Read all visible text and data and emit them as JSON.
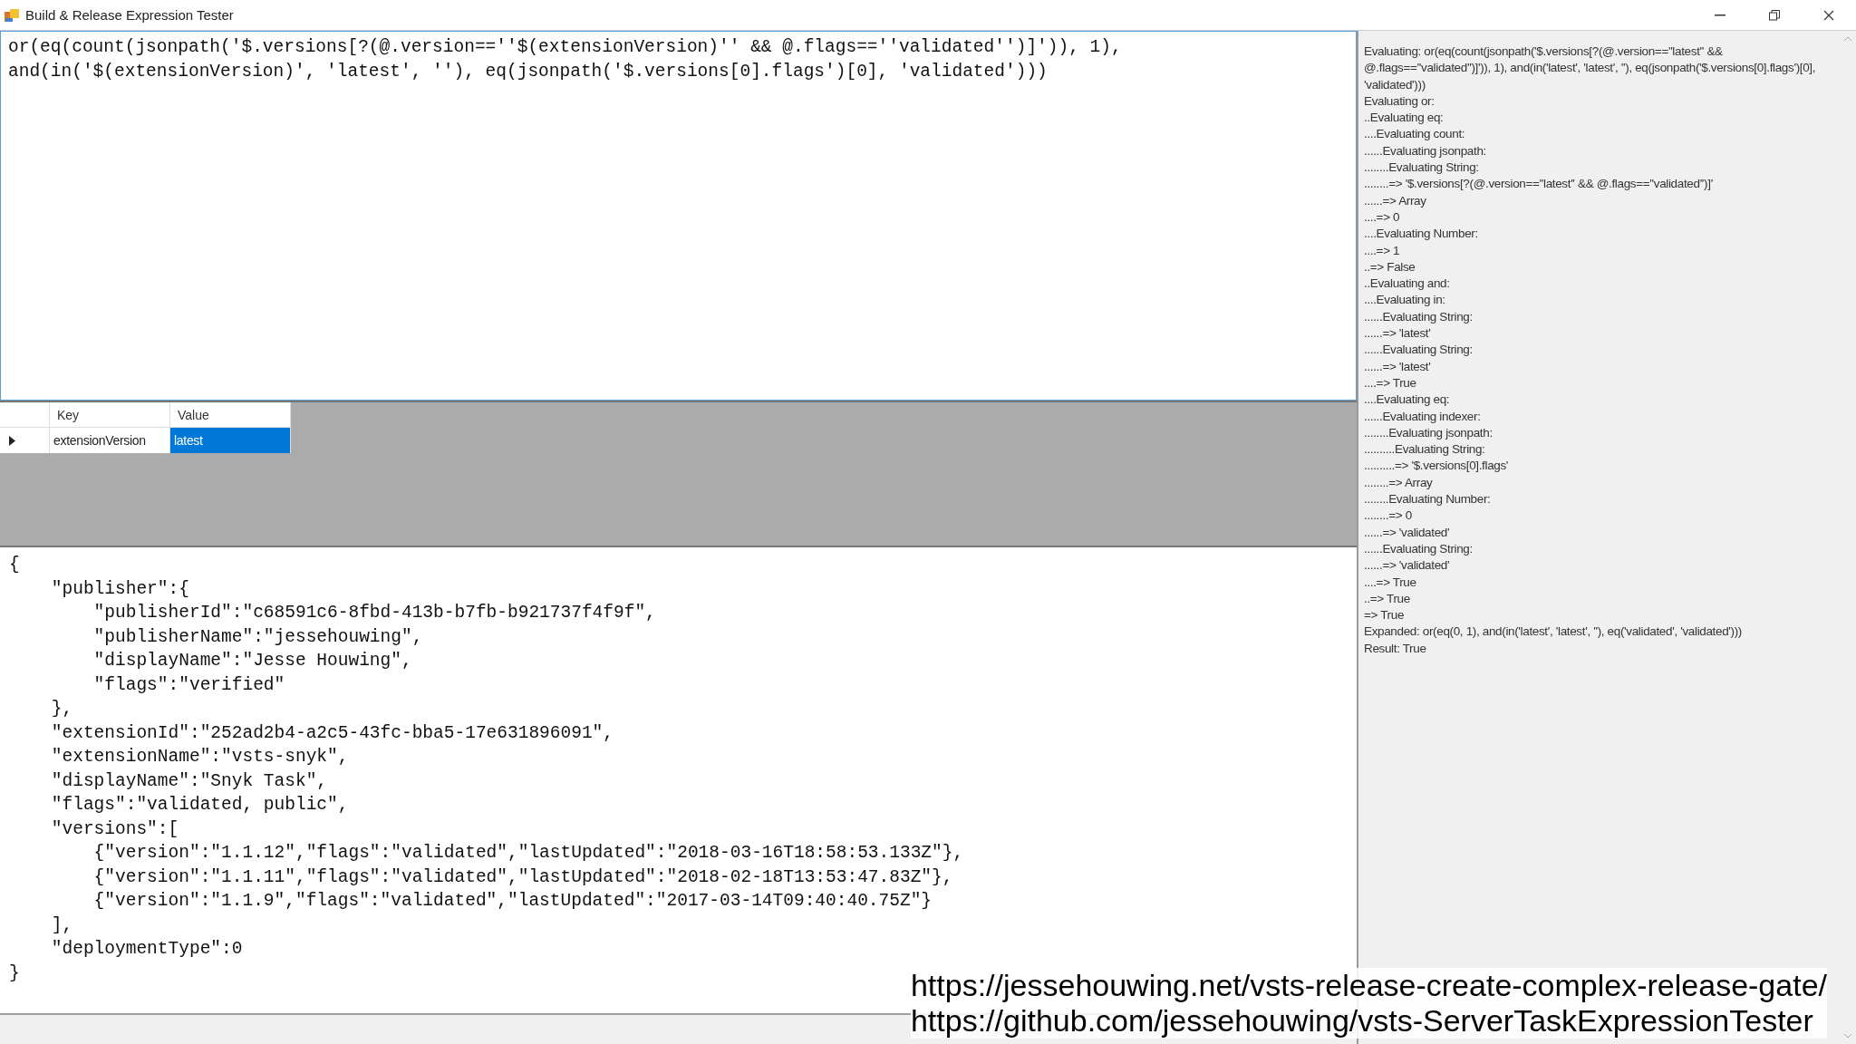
{
  "window": {
    "title": "Build & Release Expression Tester",
    "controls": [
      {
        "kind": "minimize"
      },
      {
        "kind": "restore"
      },
      {
        "kind": "close"
      }
    ]
  },
  "expression": {
    "value": "or(eq(count(jsonpath('$.versions[?(@.version==''$(extensionVersion)'' && @.flags==''validated'')]')), 1), and(in('$(extensionVersion)', 'latest', ''), eq(jsonpath('$.versions[0].flags')[0], 'validated')))"
  },
  "variables": {
    "columns": [
      "Key",
      "Value"
    ],
    "rows": [
      {
        "key": "extensionVersion",
        "value": "latest",
        "current": true,
        "selected": true
      }
    ]
  },
  "json_text": "{\n    \"publisher\":{\n        \"publisherId\":\"c68591c6-8fbd-413b-b7fb-b921737f4f9f\",\n        \"publisherName\":\"jessehouwing\",\n        \"displayName\":\"Jesse Houwing\",\n        \"flags\":\"verified\"\n    },\n    \"extensionId\":\"252ad2b4-a2c5-43fc-bba5-17e631896091\",\n    \"extensionName\":\"vsts-snyk\",\n    \"displayName\":\"Snyk Task\",\n    \"flags\":\"validated, public\",\n    \"versions\":[\n        {\"version\":\"1.1.12\",\"flags\":\"validated\",\"lastUpdated\":\"2018-03-16T18:58:53.133Z\"},\n        {\"version\":\"1.1.11\",\"flags\":\"validated\",\"lastUpdated\":\"2018-02-18T13:53:47.83Z\"},\n        {\"version\":\"1.1.9\",\"flags\":\"validated\",\"lastUpdated\":\"2017-03-14T09:40:40.75Z\"}\n    ],\n    \"deploymentType\":0\n}",
  "log": [
    "Evaluating: or(eq(count(jsonpath('$.versions[?(@.version==''latest'' && @.flags==''validated'')]')), 1), and(in('latest', 'latest', ''), eq(jsonpath('$.versions[0].flags')[0], 'validated')))",
    "Evaluating or:",
    "..Evaluating eq:",
    "....Evaluating count:",
    "......Evaluating jsonpath:",
    "........Evaluating String:",
    "........=> '$.versions[?(@.version==''latest'' && @.flags==''validated'')]'",
    "......=> Array",
    "....=> 0",
    "....Evaluating Number:",
    "....=> 1",
    "..=> False",
    "..Evaluating and:",
    "....Evaluating in:",
    "......Evaluating String:",
    "......=> 'latest'",
    "......Evaluating String:",
    "......=> 'latest'",
    "....=> True",
    "....Evaluating eq:",
    "......Evaluating indexer:",
    "........Evaluating jsonpath:",
    "..........Evaluating String:",
    "..........=> '$.versions[0].flags'",
    "........=> Array",
    "........Evaluating Number:",
    "........=> 0",
    "......=> 'validated'",
    "......Evaluating String:",
    "......=> 'validated'",
    "....=> True",
    "..=> True",
    "=> True",
    "Expanded: or(eq(0, 1), and(in('latest', 'latest', ''), eq('validated', 'validated')))",
    "Result: True"
  ],
  "overlay_links": [
    "https://jessehouwing.net/vsts-release-create-complex-release-gate/",
    "https://github.com/jessehouwing/vsts-ServerTaskExpressionTester"
  ]
}
